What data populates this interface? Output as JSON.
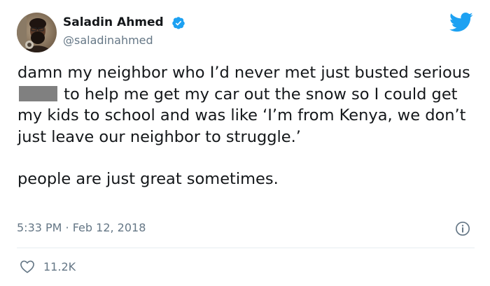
{
  "author": {
    "name": "Saladin Ahmed",
    "handle": "@saladinahmed",
    "verified": true
  },
  "tweet": {
    "text_line1_before_redaction": "damn my neighbor who I’d never met just busted serious",
    "text_after_redaction": "to help me get my car out the snow so I could get my kids to school and was like ‘I’m from Kenya, we don’t just leave our neighbor to struggle.’",
    "text_paragraph2": "people are just great sometimes.",
    "timestamp": "5:33 PM · Feb 12, 2018"
  },
  "engagement": {
    "likes": "11.2K"
  },
  "icons": {
    "brand": "twitter-bird-icon",
    "verified": "verified-badge-icon",
    "info": "info-icon",
    "like": "heart-icon"
  },
  "colors": {
    "text": "#14171a",
    "secondary": "#657786",
    "brand_blue": "#1da1f2",
    "divider": "#e6ecf0",
    "redaction": "#808080"
  }
}
